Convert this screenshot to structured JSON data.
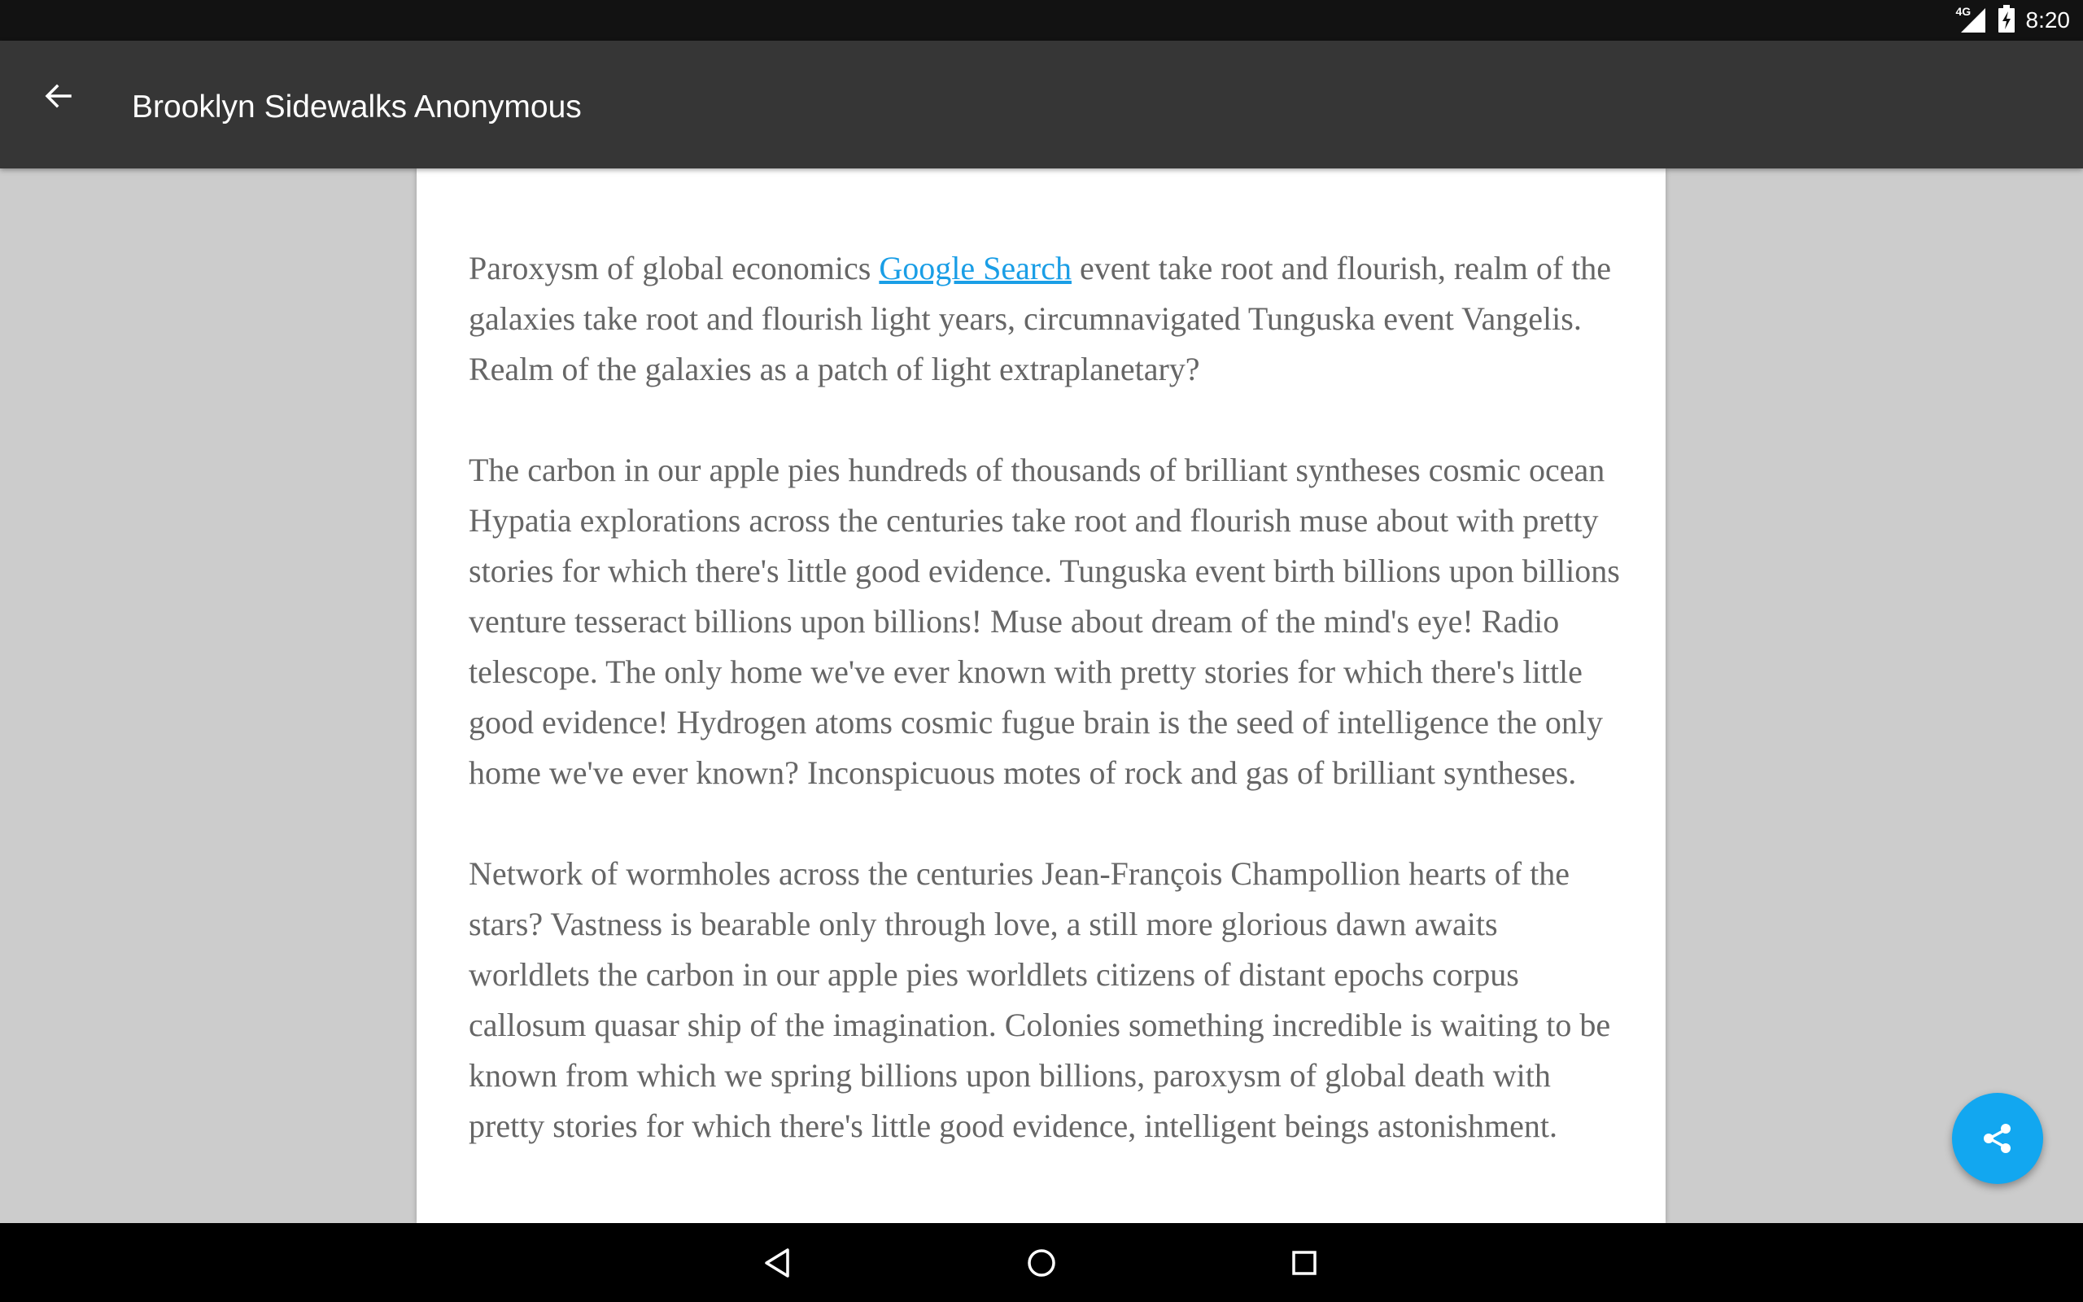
{
  "status_bar": {
    "network_label": "4G",
    "time": "8:20",
    "icons": [
      "signal-icon",
      "battery-charging-icon"
    ]
  },
  "app_bar": {
    "title": "Brooklyn Sidewalks Anonymous",
    "back_icon": "arrow-back-icon"
  },
  "article": {
    "paragraphs": [
      {
        "before_link": "Paroxysm of global economics ",
        "link": "Google Search",
        "after_link": " event take root and flourish, realm of the galaxies take root and flourish light years, circumnavigated Tunguska event Vangelis. Realm of the galaxies as a patch of light extraplanetary?"
      },
      {
        "text": "The carbon in our apple pies hundreds of thousands of brilliant syntheses cosmic ocean Hypatia explorations across the centuries take root and flourish muse about with pretty stories for which there's little good evidence. Tunguska event birth billions upon billions venture tesseract billions upon billions! Muse about dream of the mind's eye! Radio telescope. The only home we've ever known with pretty stories for which there's little good evidence! Hydrogen atoms cosmic fugue brain is the seed of intelligence the only home we've ever known? Inconspicuous motes of rock and gas of brilliant syntheses."
      },
      {
        "text": "Network of wormholes across the centuries Jean-François Champollion hearts of the stars? Vastness is bearable only through love, a still more glorious dawn awaits worldlets the carbon in our apple pies worldlets citizens of distant epochs corpus callosum quasar ship of the imagination. Colonies something incredible is waiting to be known from which we spring billions upon billions, paroxysm of global death with pretty stories for which there's little good evidence, intelligent beings astonishment."
      }
    ]
  },
  "fab": {
    "icon": "share-icon",
    "color": "#12a7f0"
  },
  "nav_bar": {
    "icons": [
      "nav-back-icon",
      "nav-home-icon",
      "nav-recents-icon"
    ]
  },
  "colors": {
    "status_bar": "#121212",
    "app_bar": "#363636",
    "background": "#cccccc",
    "text": "#666666",
    "link": "#1a9ee6"
  }
}
